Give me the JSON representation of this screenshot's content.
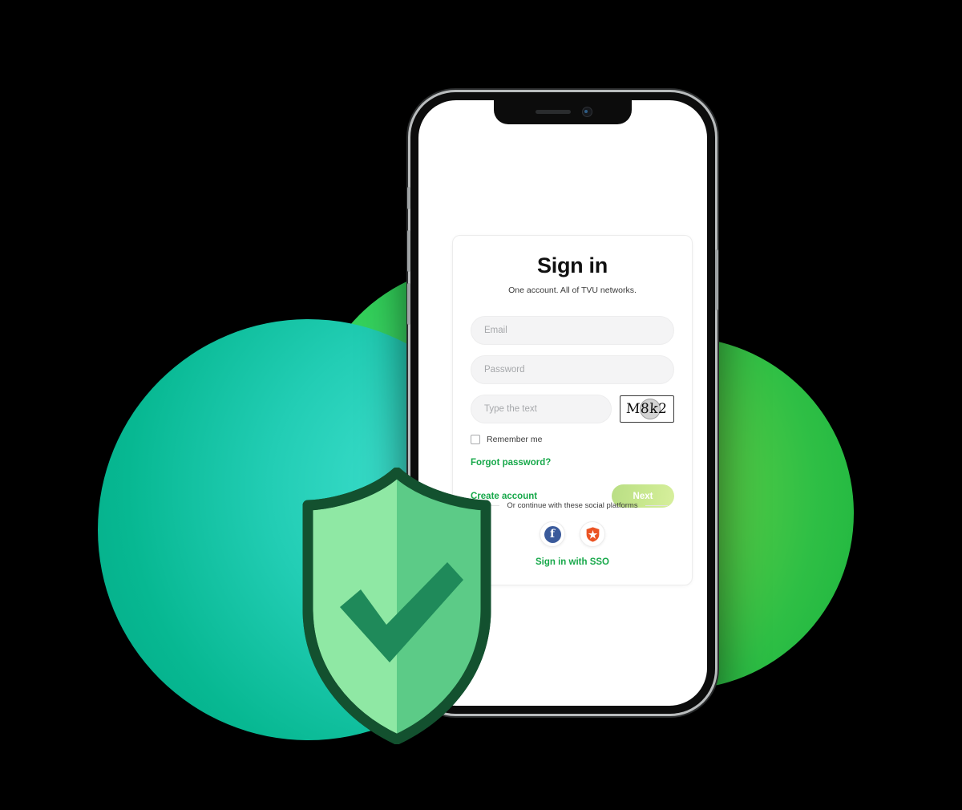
{
  "colors": {
    "brand_green": "#17a84a",
    "teal_circle": "#07b892",
    "green_circle": "#27c84a",
    "green_circle_right": "#5ecd45",
    "next_button": "#c9e88f",
    "facebook_blue": "#3a5a9b",
    "auth0_orange": "#eb5424",
    "shield_outline": "#13512f",
    "shield_light": "#8fe8a4",
    "shield_dark": "#5ccb87",
    "check_mark": "#1f8a5a"
  },
  "phone": {
    "notch": {
      "speaker_icon": "speaker-slot-icon",
      "camera_icon": "front-camera-icon"
    },
    "buttons": {
      "mute": "mute-switch",
      "volume_up": "volume-up-button",
      "volume_down": "volume-down-button",
      "power": "power-button"
    }
  },
  "signin": {
    "title": "Sign in",
    "subtitle": "One account. All of TVU networks.",
    "fields": {
      "email": {
        "value": "",
        "placeholder": "Email"
      },
      "password": {
        "value": "",
        "placeholder": "Password"
      },
      "captcha": {
        "value": "",
        "placeholder": "Type the text"
      }
    },
    "captcha_image": {
      "text": "M8k2",
      "overlay_icon": "captcha-noise-blob"
    },
    "remember_me": {
      "label": "Remember me",
      "checked": false,
      "icon": "checkbox-unchecked-icon"
    },
    "forgot_password_label": "Forgot password?",
    "create_account_label": "Create account",
    "next_button_label": "Next",
    "social": {
      "divider_text": "Or continue with these social platforms",
      "buttons": [
        {
          "name": "facebook",
          "icon": "facebook-icon",
          "glyph": "f"
        },
        {
          "name": "auth0",
          "icon": "auth0-shield-icon"
        }
      ],
      "sso_label": "Sign in with SSO"
    }
  },
  "decoration": {
    "shield_icon": "shield-check-icon",
    "circles": [
      {
        "name": "green-back-circle"
      },
      {
        "name": "green-right-circle"
      },
      {
        "name": "teal-left-circle"
      }
    ]
  }
}
